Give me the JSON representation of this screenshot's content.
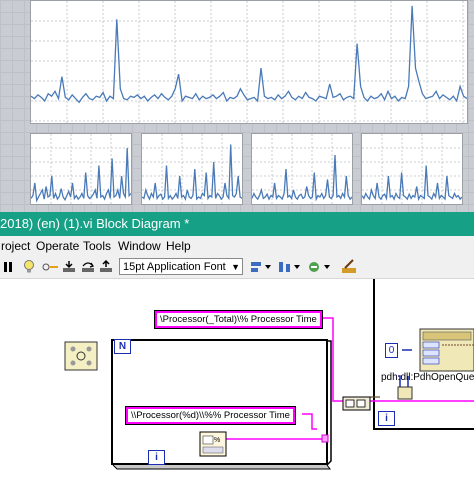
{
  "window": {
    "title": "2018) (en) (1).vi Block Diagram *"
  },
  "menu": {
    "items": [
      "roject",
      "Operate",
      "Tools",
      "Window",
      "Help"
    ]
  },
  "toolbar": {
    "font_value": "15pt Application Font"
  },
  "diagram": {
    "constant_total": "\\Processor(_Total)\\% Processor Time",
    "constant_format": "\\\\Processor(%d)\\\\%% Processor Time",
    "loop_count_label": "N",
    "loop_iteration_label": "i",
    "loop2_iteration_label": "i",
    "dll_call_label": "pdh.dll:PdhOpenQue",
    "numeric_constant": "0"
  },
  "colors": {
    "title_bar": "#16a085",
    "string_wire": "#ff00ff",
    "numeric_wire": "#1b2db0",
    "plot_line": "#4a7ab8"
  },
  "charts": {
    "main_series": [
      0.78,
      0.8,
      0.77,
      0.79,
      0.82,
      0.76,
      0.78,
      0.74,
      0.8,
      0.62,
      0.79,
      0.81,
      0.77,
      0.8,
      0.83,
      0.79,
      0.76,
      0.8,
      0.81,
      0.78,
      0.79,
      0.75,
      0.82,
      0.78,
      0.8,
      0.15,
      0.72,
      0.8,
      0.81,
      0.78,
      0.79,
      0.77,
      0.8,
      0.78,
      0.82,
      0.79,
      0.77,
      0.8,
      0.76,
      0.79,
      0.81,
      0.78,
      0.72,
      0.6,
      0.82,
      0.78,
      0.79,
      0.8,
      0.76,
      0.81,
      0.78,
      0.8,
      0.79,
      0.77,
      0.8,
      0.78,
      0.75,
      0.82,
      0.79,
      0.8,
      0.78,
      0.72,
      0.77,
      0.81,
      0.8,
      0.79,
      0.82,
      0.55,
      0.78,
      0.8,
      0.79,
      0.81,
      0.77,
      0.8,
      0.78,
      0.74,
      0.79,
      0.81,
      0.78,
      0.8,
      0.75,
      0.79,
      0.8,
      0.82,
      0.78,
      0.79,
      0.8,
      0.68,
      0.79,
      0.78,
      0.76,
      0.81,
      0.79,
      0.78,
      0.8,
      0.35,
      0.7,
      0.79,
      0.82,
      0.78,
      0.8,
      0.79,
      0.76,
      0.81,
      0.74,
      0.8,
      0.78,
      0.82,
      0.79,
      0.8,
      0.7,
      0.04,
      0.55,
      0.66,
      0.76,
      0.8,
      0.79,
      0.78,
      0.74,
      0.8,
      0.77,
      0.79,
      0.81,
      0.78,
      0.82,
      0.7,
      0.78,
      0.8
    ],
    "small_series": [
      [
        0.92,
        0.88,
        0.7,
        0.95,
        0.9,
        0.85,
        0.8,
        0.93,
        0.75,
        0.9,
        0.88,
        0.6,
        0.92,
        0.85,
        0.93,
        0.89,
        0.78,
        0.9,
        0.94,
        0.88,
        0.82,
        0.9,
        0.7,
        0.92,
        0.88,
        0.93,
        0.9,
        0.85,
        0.92,
        0.55,
        0.88,
        0.92,
        0.9,
        0.86,
        0.8,
        0.92,
        0.45,
        0.9,
        0.88,
        0.93,
        0.85,
        0.8,
        0.92,
        0.35,
        0.9,
        0.88,
        0.8,
        0.92,
        0.6,
        0.85,
        0.9,
        0.2,
        0.88,
        0.85
      ],
      [
        0.9,
        0.92,
        0.8,
        0.88,
        0.93,
        0.85,
        0.9,
        0.7,
        0.92,
        0.88,
        0.86,
        0.93,
        0.9,
        0.45,
        0.92,
        0.88,
        0.93,
        0.9,
        0.85,
        0.92,
        0.6,
        0.9,
        0.88,
        0.93,
        0.8,
        0.9,
        0.92,
        0.88,
        0.5,
        0.93,
        0.9,
        0.92,
        0.85,
        0.88,
        0.55,
        0.92,
        0.88,
        0.9,
        0.4,
        0.92,
        0.85,
        0.88,
        0.93,
        0.9,
        0.7,
        0.88,
        0.92,
        0.15,
        0.88,
        0.9,
        0.85,
        0.6,
        0.9,
        0.92
      ],
      [
        0.92,
        0.85,
        0.9,
        0.93,
        0.88,
        0.8,
        0.92,
        0.9,
        0.86,
        0.93,
        0.88,
        0.9,
        0.7,
        0.92,
        0.88,
        0.9,
        0.93,
        0.85,
        0.5,
        0.9,
        0.88,
        0.92,
        0.8,
        0.9,
        0.93,
        0.88,
        0.86,
        0.92,
        0.9,
        0.75,
        0.88,
        0.92,
        0.9,
        0.55,
        0.93,
        0.88,
        0.9,
        0.85,
        0.92,
        0.88,
        0.65,
        0.9,
        0.92,
        0.88,
        0.3,
        0.9,
        0.88,
        0.92,
        0.85,
        0.9,
        0.6,
        0.88,
        0.93,
        0.9
      ],
      [
        0.88,
        0.92,
        0.85,
        0.9,
        0.93,
        0.8,
        0.88,
        0.92,
        0.7,
        0.9,
        0.93,
        0.88,
        0.86,
        0.92,
        0.6,
        0.9,
        0.88,
        0.93,
        0.85,
        0.9,
        0.92,
        0.55,
        0.88,
        0.9,
        0.93,
        0.86,
        0.92,
        0.88,
        0.9,
        0.75,
        0.93,
        0.88,
        0.9,
        0.92,
        0.45,
        0.88,
        0.9,
        0.93,
        0.85,
        0.9,
        0.7,
        0.92,
        0.88,
        0.9,
        0.93,
        0.6,
        0.88,
        0.9,
        0.92,
        0.85,
        0.9,
        0.88,
        0.93,
        0.9
      ]
    ]
  }
}
